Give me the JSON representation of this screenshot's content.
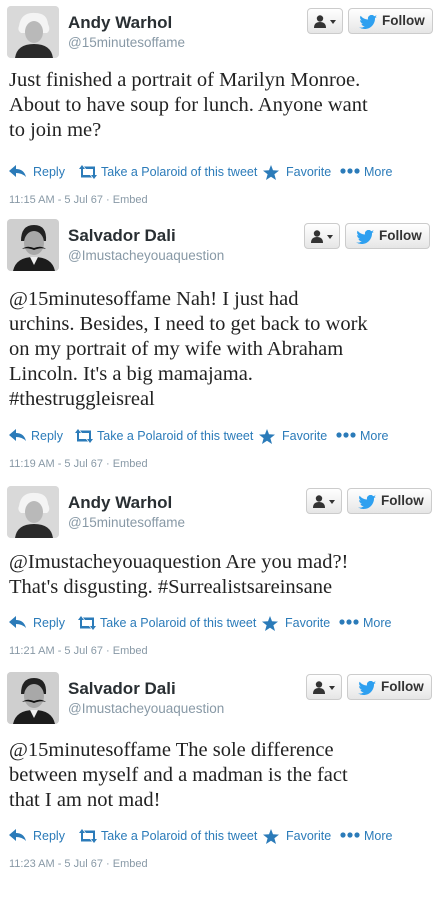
{
  "colors": {
    "link": "#2b7bb9",
    "handle": "#8899a6",
    "follow_bird": "#2ea0f0"
  },
  "buttons": {
    "follow_label": "Follow",
    "user_menu_icon": "person-dropdown-icon"
  },
  "actions": {
    "reply": "Reply",
    "retweet": "Take a Polaroid of this tweet",
    "favorite": "Favorite",
    "more": "More"
  },
  "tweets": [
    {
      "name": "Andy Warhol",
      "handle": "@15minutesoffame",
      "lines": [
        "Just finished a portrait of Marilyn Monroe.",
        "About to have soup for lunch. Anyone want",
        "to join me?"
      ],
      "time": "11:15 AM - 5 Jul 67",
      "embed": "Embed"
    },
    {
      "name": "Salvador Dali",
      "handle": "@Imustacheyouaquestion",
      "lines": [
        "@15minutesoffame Nah! I just had",
        "urchins. Besides, I need to get back to work",
        "on my portrait of my wife with Abraham",
        "Lincoln. It's a big mamajama.",
        "#thestruggleisreal"
      ],
      "time": "11:19 AM - 5 Jul 67",
      "embed": "Embed"
    },
    {
      "name": "Andy Warhol",
      "handle": "@15minutesoffame",
      "lines": [
        "@Imustacheyouaquestion Are you mad?!",
        "That's disgusting. #Surrealistsareinsane"
      ],
      "time": "11:21 AM - 5 Jul 67",
      "embed": "Embed"
    },
    {
      "name": "Salvador Dali",
      "handle": "@Imustacheyouaquestion",
      "lines": [
        "@15minutesoffame The sole difference",
        "between myself and a madman is the fact",
        "that I am not mad!"
      ],
      "time": "11:23 AM - 5 Jul 67",
      "embed": "Embed"
    }
  ]
}
